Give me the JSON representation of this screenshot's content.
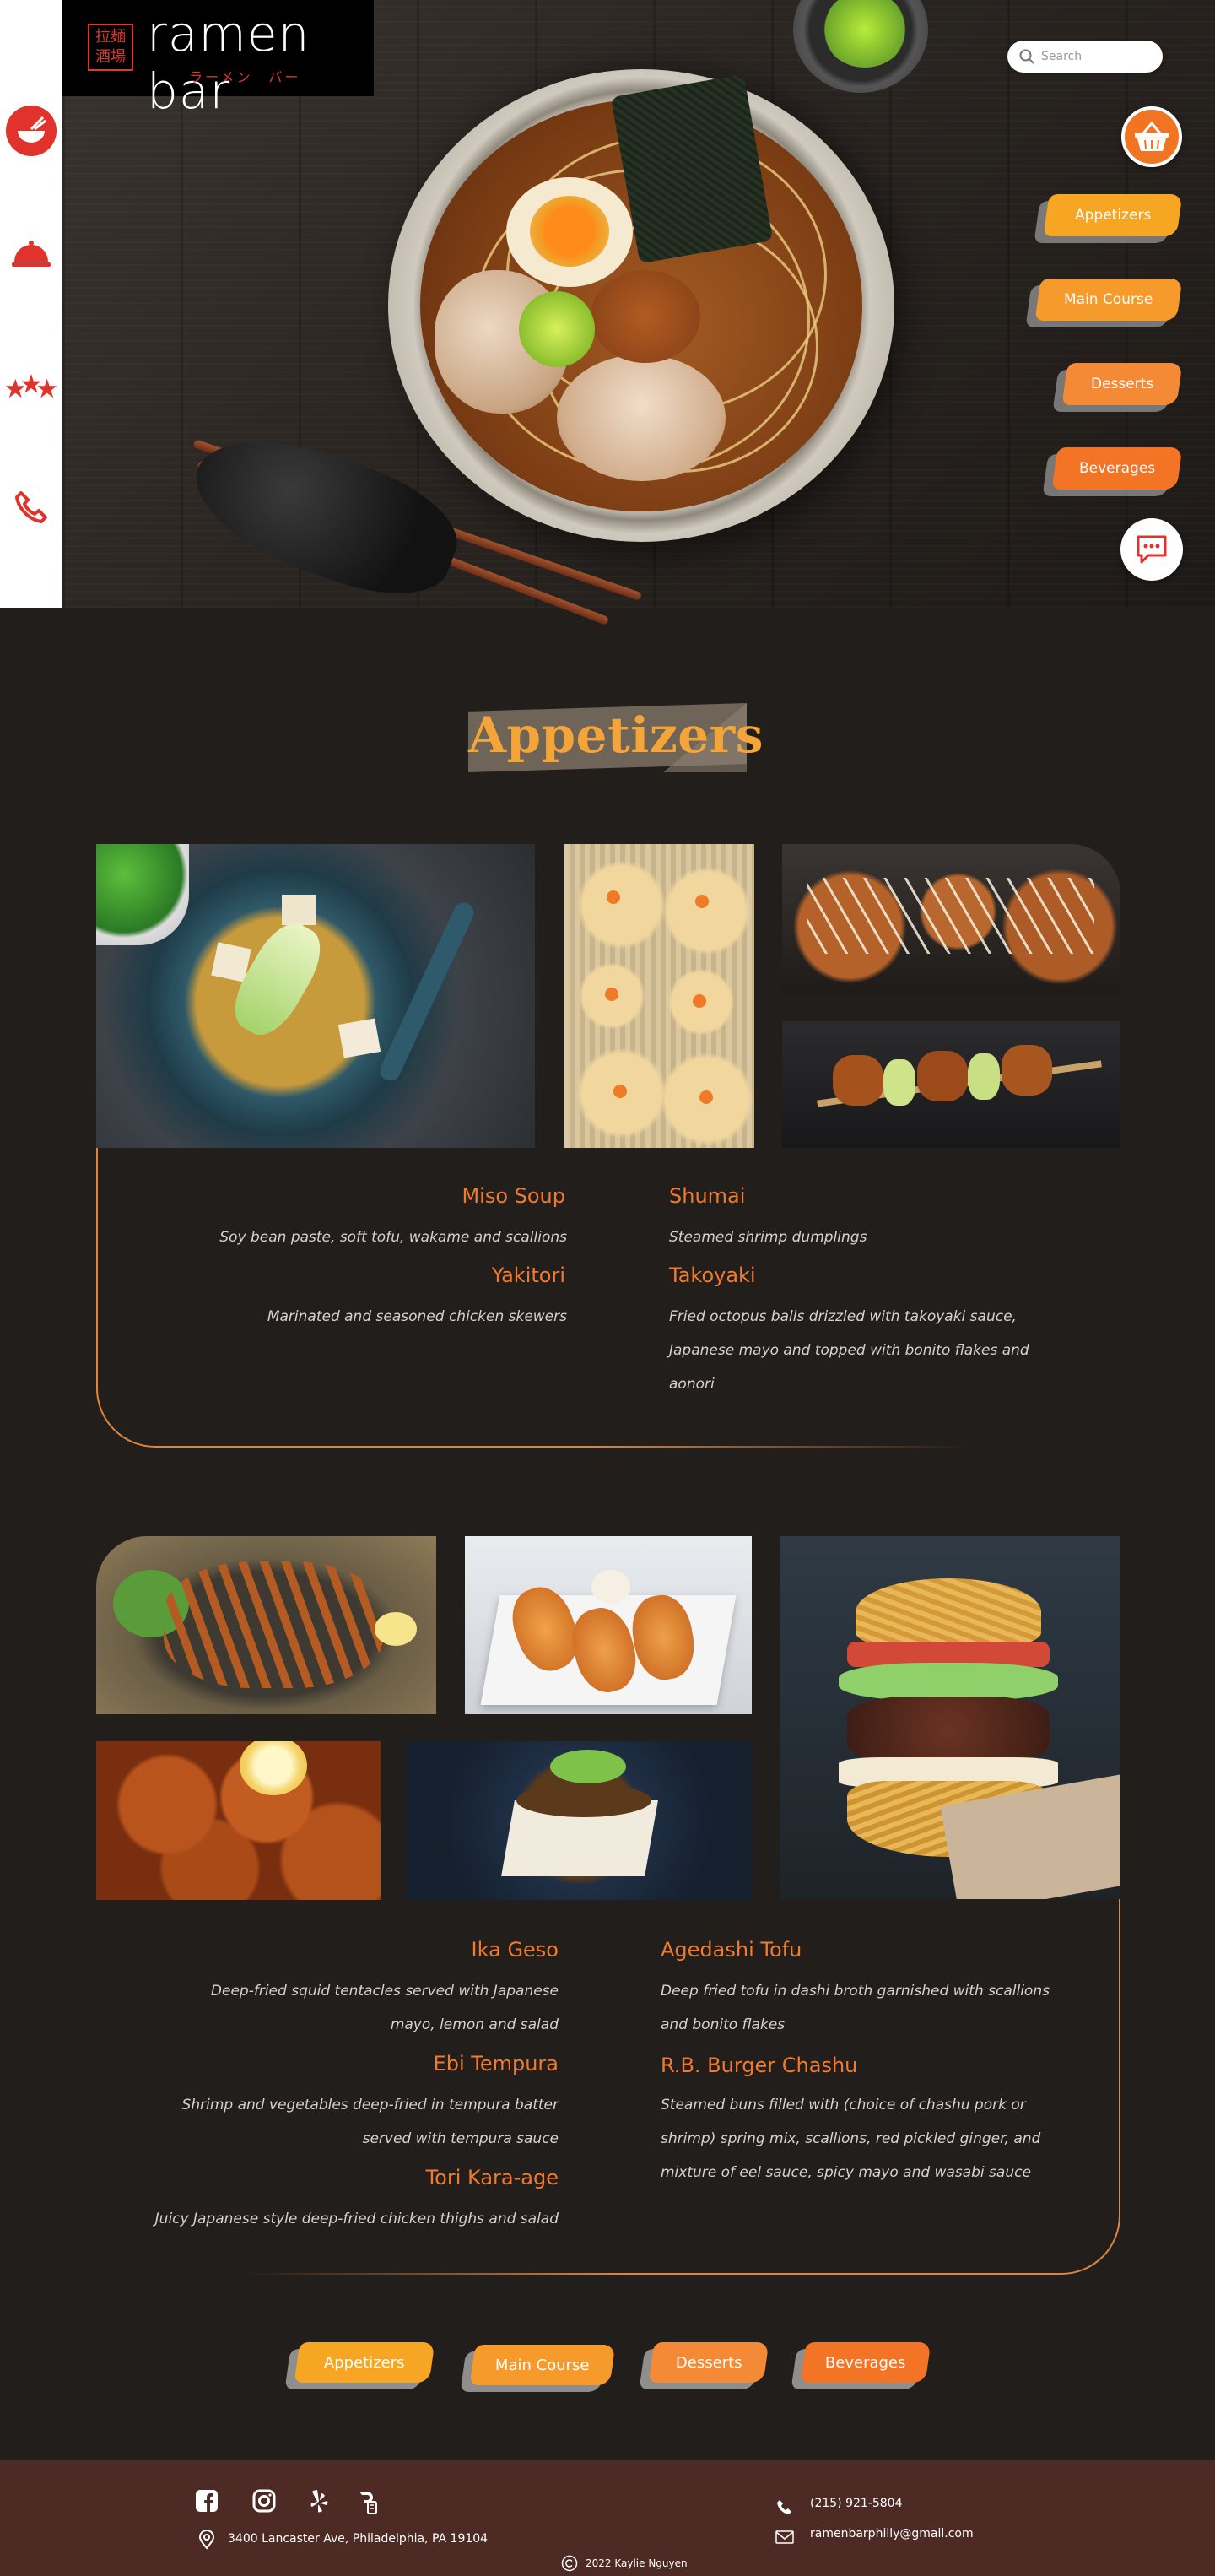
{
  "brand": {
    "name": "ramen bar",
    "seal": "拉麺酒場",
    "subtitle": "ラーメン　バー"
  },
  "search": {
    "placeholder": "Search"
  },
  "hero_nav": [
    {
      "label": "Appetizers",
      "color": "#f6a623"
    },
    {
      "label": "Main Course",
      "color": "#f69b2b"
    },
    {
      "label": "Desserts",
      "color": "#f58a36"
    },
    {
      "label": "Beverages",
      "color": "#f47426"
    }
  ],
  "side_nav": [
    {
      "icon": "ramen-bowl-icon"
    },
    {
      "icon": "cloche-icon"
    },
    {
      "icon": "stars-icon"
    },
    {
      "icon": "phone-icon"
    }
  ],
  "section": {
    "title": "Appetizers"
  },
  "group1": [
    {
      "name": "Miso Soup",
      "desc": "Soy bean paste, soft tofu, wakame and scallions"
    },
    {
      "name": "Yakitori",
      "desc": "Marinated and seasoned chicken skewers"
    },
    {
      "name": "Shumai",
      "desc": "Steamed shrimp dumplings"
    },
    {
      "name": "Takoyaki",
      "desc_lines": [
        "Fried octopus balls drizzled with takoyaki sauce,",
        "Japanese mayo and topped with bonito flakes and",
        "aonori"
      ]
    }
  ],
  "group2": [
    {
      "name": "Ika Geso",
      "desc_lines": [
        "Deep-fried squid tentacles served with Japanese",
        "mayo, lemon and salad"
      ]
    },
    {
      "name": "Ebi Tempura",
      "desc_lines": [
        "Shrimp and vegetables deep-fried in tempura batter",
        "served with tempura sauce"
      ]
    },
    {
      "name": "Tori Kara-age",
      "desc": "Juicy Japanese style deep-fried chicken thighs and salad"
    },
    {
      "name": "Agedashi Tofu",
      "desc_lines": [
        "Deep fried tofu in dashi broth garnished with scallions",
        "and bonito flakes"
      ]
    },
    {
      "name": "R.B. Burger Chashu",
      "desc_lines": [
        "Steamed buns filled with (choice of chashu pork or",
        "shrimp) spring mix, scallions, red pickled ginger, and",
        "mixture of eel sauce, spicy mayo and wasabi sauce"
      ]
    }
  ],
  "bottom_nav": [
    {
      "label": "Appetizers",
      "color": "#f6a623"
    },
    {
      "label": "Main Course",
      "color": "#f69b2b"
    },
    {
      "label": "Desserts",
      "color": "#f58a36"
    },
    {
      "label": "Beverages",
      "color": "#f47426"
    }
  ],
  "footer": {
    "address": "3400 Lancaster Ave, Philadelphia, PA 19104",
    "phone": "(215) 921-5804",
    "email": "ramenbarphilly@gmail.com",
    "copyright": "2022 Kaylie Nguyen",
    "social": [
      "facebook-icon",
      "instagram-icon",
      "yelp-icon",
      "doordash-icon"
    ]
  },
  "colors": {
    "accent": "#f07a30",
    "title": "#f4a53a",
    "bg": "#221e1b",
    "footer": "#4d2b24",
    "sidebar_icon": "#e0332c"
  }
}
